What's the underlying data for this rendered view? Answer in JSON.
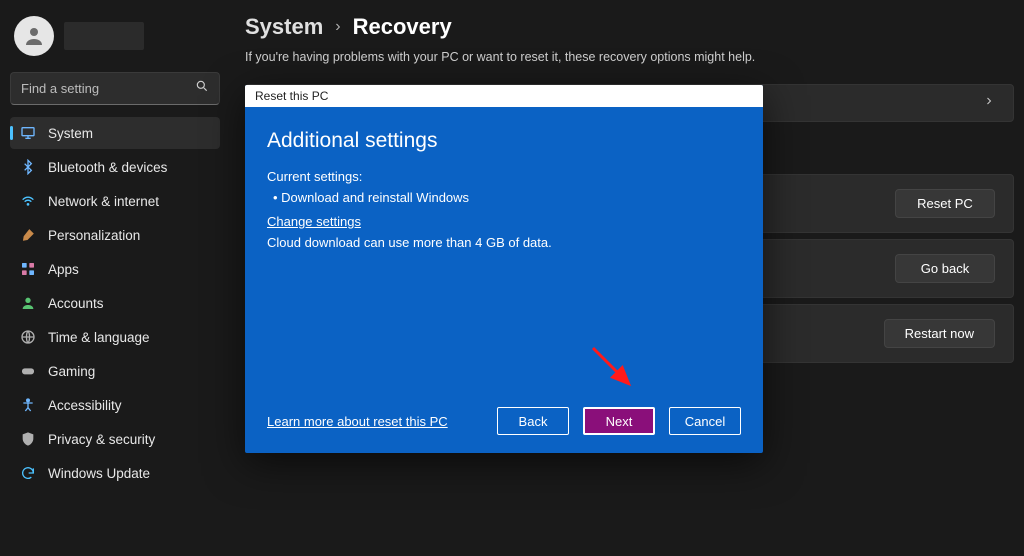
{
  "search": {
    "placeholder": "Find a setting"
  },
  "nav": {
    "items": [
      {
        "label": "System"
      },
      {
        "label": "Bluetooth & devices"
      },
      {
        "label": "Network & internet"
      },
      {
        "label": "Personalization"
      },
      {
        "label": "Apps"
      },
      {
        "label": "Accounts"
      },
      {
        "label": "Time & language"
      },
      {
        "label": "Gaming"
      },
      {
        "label": "Accessibility"
      },
      {
        "label": "Privacy & security"
      },
      {
        "label": "Windows Update"
      }
    ]
  },
  "breadcrumb": {
    "parent": "System",
    "sep": "›",
    "current": "Recovery"
  },
  "page": {
    "subdesc": "If you're having problems with your PC or want to reset it, these recovery options might help."
  },
  "cards": {
    "reset": "Reset PC",
    "goback": "Go back",
    "restart": "Restart now"
  },
  "dialog": {
    "title": "Reset this PC",
    "heading": "Additional settings",
    "current_label": "Current settings:",
    "bullet1": "Download and reinstall Windows",
    "change": "Change settings",
    "note": "Cloud download can use more than 4 GB of data.",
    "learn": "Learn more about reset this PC",
    "back": "Back",
    "next": "Next",
    "cancel": "Cancel"
  }
}
